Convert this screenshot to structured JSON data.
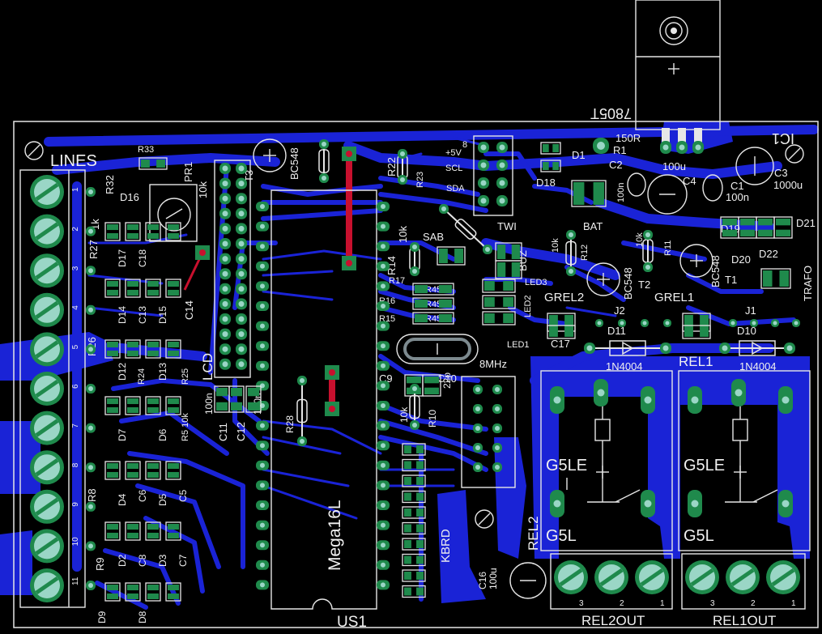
{
  "board": {
    "labels": {
      "lines": "LINES",
      "r33": "R33",
      "r32": "R32",
      "r27": "R27",
      "r27_val": "1k",
      "r26": "R26",
      "r25": "R25",
      "r24": "R24",
      "r5_10k": "R5 10k",
      "r8": "R8",
      "r9": "R9",
      "r28": "R28",
      "r22": "R22",
      "r23": "R23",
      "r14": "R14",
      "r14_val": "10k",
      "r17": "R17",
      "r16": "R16",
      "r15": "R15",
      "r450a": "R450",
      "r450b": "R450",
      "r450c": "R450",
      "r12": "R12",
      "r11": "R11",
      "r10": "R10",
      "r10k_a": "10k",
      "r10k_b": "10k",
      "r10k_c": "10k",
      "r1": "R1",
      "r1_val": "150R",
      "d16": "D16",
      "d17": "D17",
      "d14": "D14",
      "d15": "D15",
      "d12": "D12",
      "d13": "D13",
      "d7": "D7",
      "d6": "D6",
      "d4": "D4",
      "d5": "D5",
      "d2": "D2",
      "d3": "D3",
      "d9": "D9",
      "d8": "D8",
      "d1": "D1",
      "d18": "D18",
      "d19": "D19",
      "d20": "D20",
      "d21": "D21",
      "d22": "D22",
      "d11": "D11",
      "d10": "D10",
      "c18": "C18",
      "c13": "C13",
      "c14": "C14",
      "c6": "C6",
      "c5": "C5",
      "c8": "C8",
      "c7": "C7",
      "c11": "C11",
      "c12": "C12",
      "c100n_a": "100n",
      "c100n_b": "100n",
      "c9": "C9",
      "c10": "C10",
      "c22": "22p",
      "c17": "C17",
      "c16": "C16",
      "c16_val": "100u",
      "c2": "C2",
      "c2_val": "100n",
      "c4": "C4",
      "c4_val": "100u",
      "c1": "C1",
      "c1_val": "100n",
      "c3": "C3",
      "c3_val": "1000u",
      "pr1": "PR1",
      "pr1_val": "10k",
      "lcd": "LCD",
      "t3": "T3",
      "bc548_top": "BC548",
      "mega": "Mega16L",
      "us1": "US1",
      "xtal": "8MHz",
      "plus5v": "+5V",
      "scl": "SCL",
      "sda": "SDA",
      "pin8": "8",
      "twi": "TWI",
      "sab": "SAB",
      "buz": "BUZ",
      "bat": "BAT",
      "led3": "LED3",
      "led2": "LED2",
      "led1": "LED1",
      "grel2": "GREL2",
      "grel1": "GREL1",
      "t2": "T2",
      "t1": "T1",
      "bc548_t2": "BC548",
      "bc548_t1": "BC548",
      "j2": "J2",
      "j1": "J1",
      "n4004_a": "1N4004",
      "n4004_b": "1N4004",
      "rel1": "REL1",
      "rel2": "REL2",
      "g5le_a": "G5LE",
      "g5le_b": "G5LE",
      "g5l_a": "G5L",
      "g5l_b": "G5L",
      "kbrd": "KBRD",
      "trafo": "TRAFO",
      "ic1": "IC1",
      "reg": "7805T",
      "rel2out": "REL2OUT",
      "rel1out": "REL1OUT",
      "p3a": "3",
      "p2a": "2",
      "p1a": "1",
      "p3b": "3",
      "p2b": "2",
      "p1b": "1"
    },
    "line_pins": [
      "1",
      "2",
      "3",
      "4",
      "5",
      "6",
      "7",
      "8",
      "9",
      "10",
      "11"
    ]
  }
}
